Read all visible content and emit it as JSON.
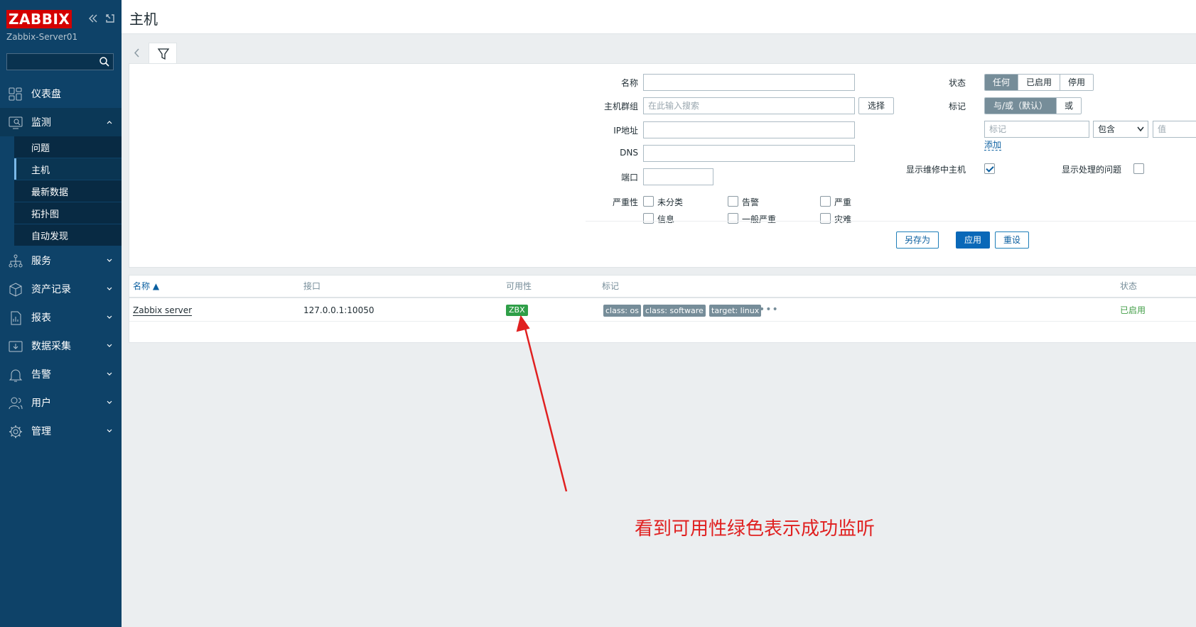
{
  "sidebar": {
    "logo": "ZABBIX",
    "server_name": "Zabbix-Server01",
    "search_placeholder": "",
    "items": [
      {
        "label": "仪表盘",
        "icon": "dashboard-icon"
      },
      {
        "label": "监测",
        "icon": "monitoring-icon",
        "open": true
      },
      {
        "label": "服务",
        "icon": "services-icon"
      },
      {
        "label": "资产记录",
        "icon": "inventory-icon"
      },
      {
        "label": "报表",
        "icon": "reports-icon"
      },
      {
        "label": "数据采集",
        "icon": "data-collection-icon"
      },
      {
        "label": "告警",
        "icon": "bell-icon"
      },
      {
        "label": "用户",
        "icon": "users-icon"
      },
      {
        "label": "管理",
        "icon": "gear-icon"
      }
    ],
    "submenu": [
      "问题",
      "主机",
      "最新数据",
      "拓扑图",
      "自动发现"
    ],
    "active_submenu": "主机"
  },
  "header": {
    "title": "主机"
  },
  "filter": {
    "name_label": "名称",
    "name_value": "",
    "hostgroup_label": "主机群组",
    "hostgroup_placeholder": "在此输入搜索",
    "select_button": "选择",
    "ip_label": "IP地址",
    "dns_label": "DNS",
    "port_label": "端口",
    "severity_label": "严重性",
    "severities": [
      "未分类",
      "告警",
      "严重",
      "信息",
      "一般严重",
      "灾难"
    ],
    "status_label": "状态",
    "status_options": [
      "任何",
      "已启用",
      "停用"
    ],
    "status_selected": "任何",
    "tags_label": "标记",
    "tags_options": [
      "与/或（默认）",
      "或"
    ],
    "tags_selected": "与/或（默认）",
    "tag_placeholder": "标记",
    "tag_operator": "包含",
    "tag_value_placeholder": "值",
    "add_link": "添加",
    "show_maintenance_label": "显示维修中主机",
    "show_maintenance_checked": true,
    "show_suppressed_label": "显示处理的问题",
    "show_suppressed_checked": false,
    "save_as": "另存为",
    "apply": "应用",
    "reset": "重设"
  },
  "table": {
    "columns": [
      "名称 ▲",
      "接口",
      "可用性",
      "标记",
      "状态"
    ],
    "rows": [
      {
        "name": "Zabbix server",
        "interface": "127.0.0.1:10050",
        "availability": "ZBX",
        "tags": [
          "class: os",
          "class: software",
          "target: linux"
        ],
        "more": "•••",
        "status": "已启用"
      }
    ]
  },
  "annotation": {
    "text": "看到可用性绿色表示成功监听",
    "color": "#e02020"
  },
  "colors": {
    "sidebar": "#0e4268",
    "logo": "#d40000",
    "available": "#2f9f48",
    "enabled": "#429e47"
  }
}
